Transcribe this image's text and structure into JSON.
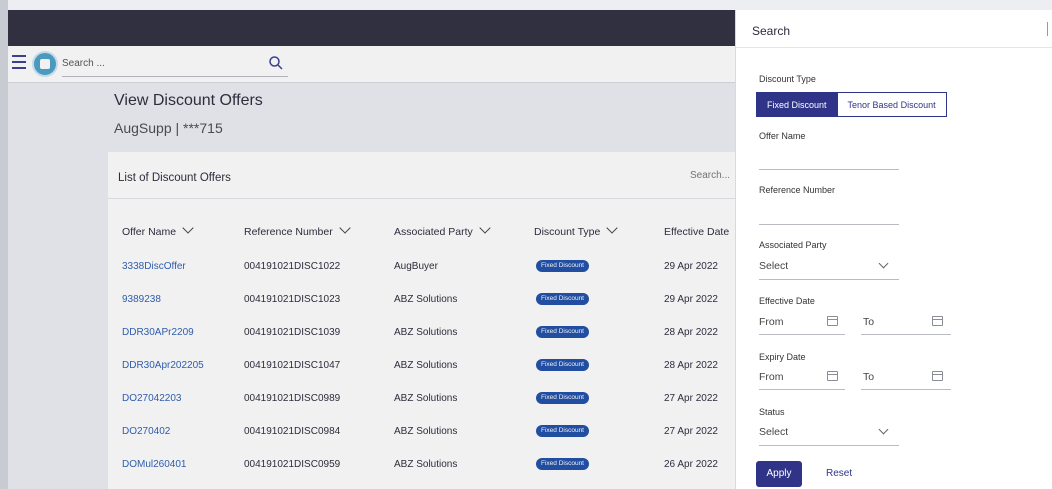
{
  "header": {
    "search_placeholder": "Search ..."
  },
  "page": {
    "title": "View Discount Offers",
    "subtitle": "AugSupp | ***715"
  },
  "list": {
    "title": "List of Discount Offers",
    "search_placeholder": "Search...",
    "columns": [
      "Offer Name",
      "Reference Number",
      "Associated Party",
      "Discount Type",
      "Effective Date"
    ],
    "rows": [
      {
        "offer_name": "3338DiscOffer",
        "reference": "004191021DISC1022",
        "party": "AugBuyer",
        "type": "Fixed Discount",
        "date": "29 Apr 2022"
      },
      {
        "offer_name": "9389238",
        "reference": "004191021DISC1023",
        "party": "ABZ Solutions",
        "type": "Fixed Discount",
        "date": "29 Apr 2022"
      },
      {
        "offer_name": "DDR30APr2209",
        "reference": "004191021DISC1039",
        "party": "ABZ Solutions",
        "type": "Fixed Discount",
        "date": "28 Apr 2022"
      },
      {
        "offer_name": "DDR30Apr202205",
        "reference": "004191021DISC1047",
        "party": "ABZ Solutions",
        "type": "Fixed Discount",
        "date": "28 Apr 2022"
      },
      {
        "offer_name": "DO27042203",
        "reference": "004191021DISC0989",
        "party": "ABZ Solutions",
        "type": "Fixed Discount",
        "date": "27 Apr 2022"
      },
      {
        "offer_name": "DO270402",
        "reference": "004191021DISC0984",
        "party": "ABZ Solutions",
        "type": "Fixed Discount",
        "date": "27 Apr 2022"
      },
      {
        "offer_name": "DOMul260401",
        "reference": "004191021DISC0959",
        "party": "ABZ Solutions",
        "type": "Fixed Discount",
        "date": "26 Apr 2022"
      }
    ]
  },
  "panel": {
    "title": "Search",
    "discount_type_label": "Discount Type",
    "discount_types": [
      "Fixed Discount",
      "Tenor Based Discount"
    ],
    "selected_discount_type": "Fixed Discount",
    "offer_name_label": "Offer Name",
    "offer_name_value": "",
    "reference_number_label": "Reference Number",
    "reference_number_value": "",
    "associated_party_label": "Associated Party",
    "associated_party_value": "Select",
    "effective_date_label": "Effective Date",
    "expiry_date_label": "Expiry Date",
    "from_label": "From",
    "to_label": "To",
    "status_label": "Status",
    "status_value": "Select",
    "apply_label": "Apply",
    "reset_label": "Reset"
  },
  "colors": {
    "brand_primary": "#2f3488",
    "link": "#2d5fb3",
    "badge": "#1f4fa8",
    "topbar": "#2e2e3e"
  }
}
